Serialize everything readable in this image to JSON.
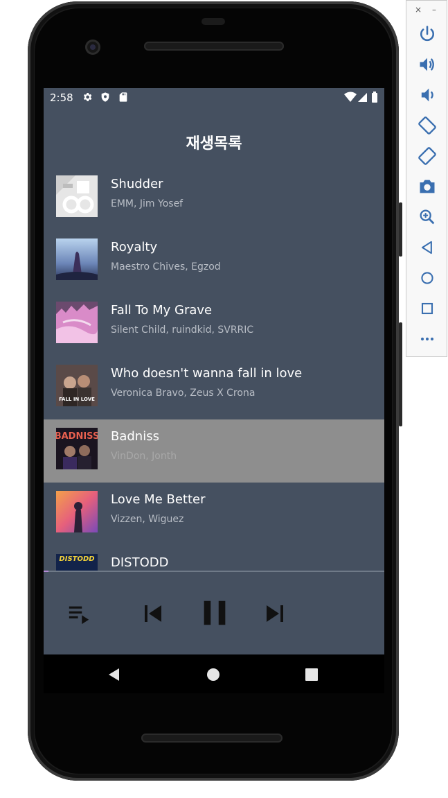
{
  "status_bar": {
    "time": "2:58",
    "left_icons": [
      "gear-icon",
      "shield-icon",
      "sd-card-icon"
    ],
    "right_icons": [
      "wifi-icon",
      "signal-icon",
      "battery-icon"
    ]
  },
  "page_title": "재생목록",
  "playlist": [
    {
      "title": "Shudder",
      "artist": "EMM, Jim Yosef",
      "selected": false
    },
    {
      "title": "Royalty",
      "artist": "Maestro Chives, Egzod",
      "selected": false
    },
    {
      "title": "Fall To My Grave",
      "artist": "Silent Child, ruindkid, SVRRIC",
      "selected": false
    },
    {
      "title": "Who doesn't wanna fall in love",
      "artist": "Veronica Bravo, Zeus X Crona",
      "selected": false
    },
    {
      "title": "Badniss",
      "artist": "VinDon, Jonth",
      "selected": true
    },
    {
      "title": "Love Me Better",
      "artist": "Vizzen, Wiguez",
      "selected": false
    },
    {
      "title": "DISTODD",
      "artist": "",
      "selected": false
    }
  ],
  "album_art_text": {
    "track_3": "FALL IN LOVE",
    "track_4": "BADNISS",
    "track_6": "DISTODD"
  },
  "player": {
    "progress": 0.015,
    "controls": [
      "playlist-icon",
      "skip-previous-icon",
      "pause-icon",
      "skip-next-icon"
    ]
  },
  "nav_bar": [
    "back-icon",
    "home-icon",
    "recents-icon"
  ],
  "emulator_toolbar": {
    "close": "×",
    "minimize": "–",
    "buttons": [
      "power-icon",
      "volume-up-icon",
      "volume-down-icon",
      "rotate-left-icon",
      "rotate-right-icon",
      "camera-icon",
      "zoom-icon",
      "back-icon",
      "home-icon",
      "overview-icon",
      "more-icon"
    ]
  }
}
